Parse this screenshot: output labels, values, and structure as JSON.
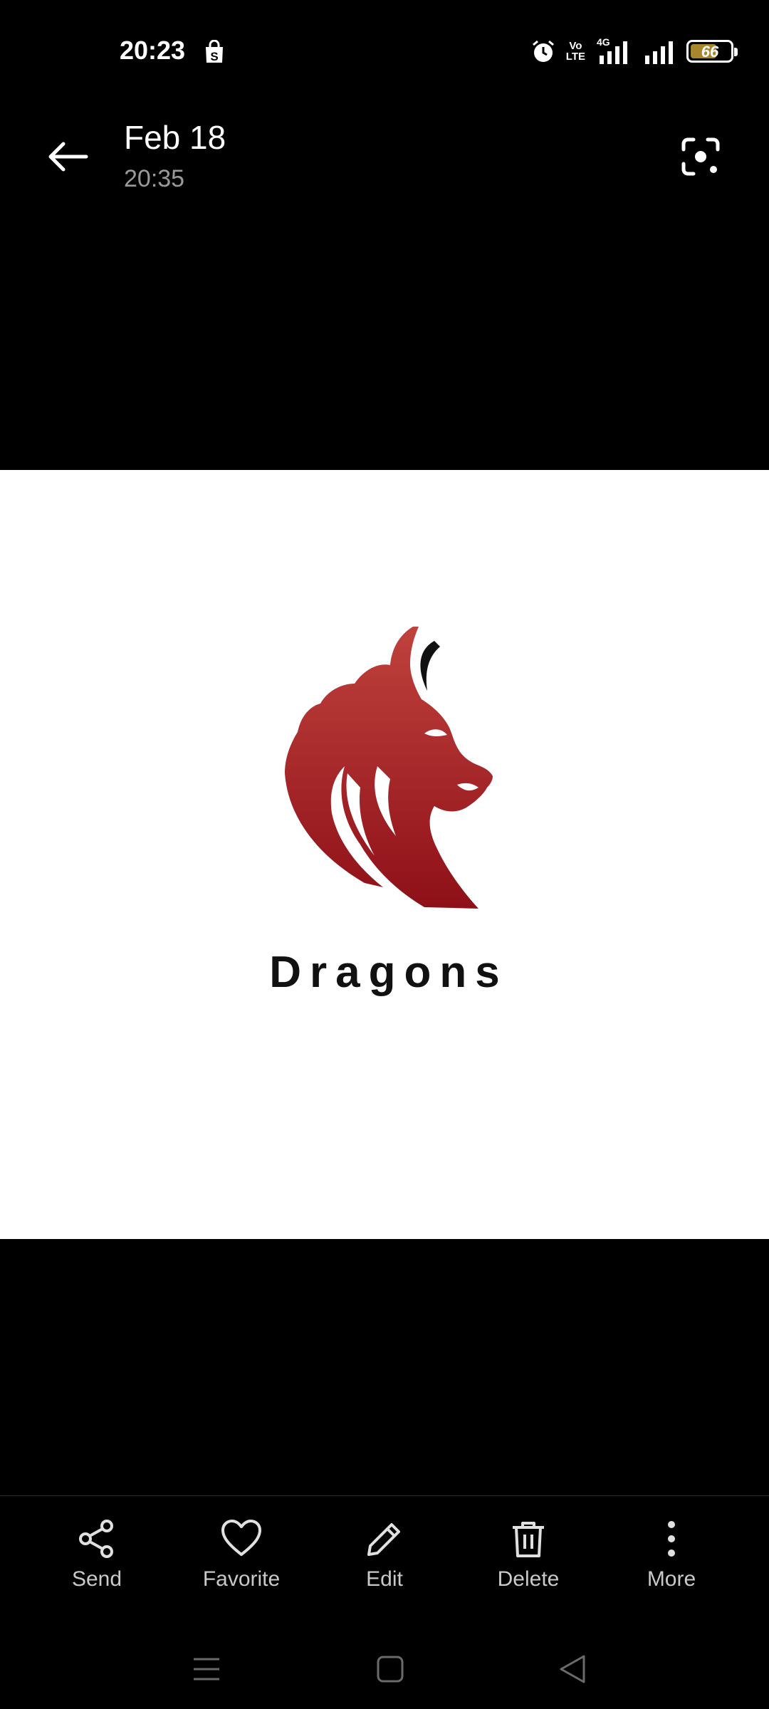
{
  "status_bar": {
    "time": "20:23",
    "volte_label_top": "Vo",
    "volte_label_bottom": "LTE",
    "network_type": "4G",
    "battery_percent": "66",
    "battery_level": 0.66,
    "icons": [
      "shopping-bag-icon",
      "alarm-icon",
      "volte-icon",
      "signal-icon",
      "signal-icon",
      "battery-icon"
    ]
  },
  "header": {
    "date": "Feb 18",
    "time": "20:35",
    "back_icon": "arrow-left-icon",
    "lens_icon": "lens-scan-icon"
  },
  "photo": {
    "brand_text": "Dragons",
    "logo_color_top": "#c0423d",
    "logo_color_bottom": "#8e1018",
    "background": "#ffffff"
  },
  "actions": [
    {
      "label": "Send",
      "icon": "share-icon"
    },
    {
      "label": "Favorite",
      "icon": "heart-icon"
    },
    {
      "label": "Edit",
      "icon": "pencil-icon"
    },
    {
      "label": "Delete",
      "icon": "trash-icon"
    },
    {
      "label": "More",
      "icon": "more-vertical-icon"
    }
  ],
  "nav": {
    "icons": [
      "menu-icon",
      "home-icon",
      "back-icon"
    ]
  }
}
